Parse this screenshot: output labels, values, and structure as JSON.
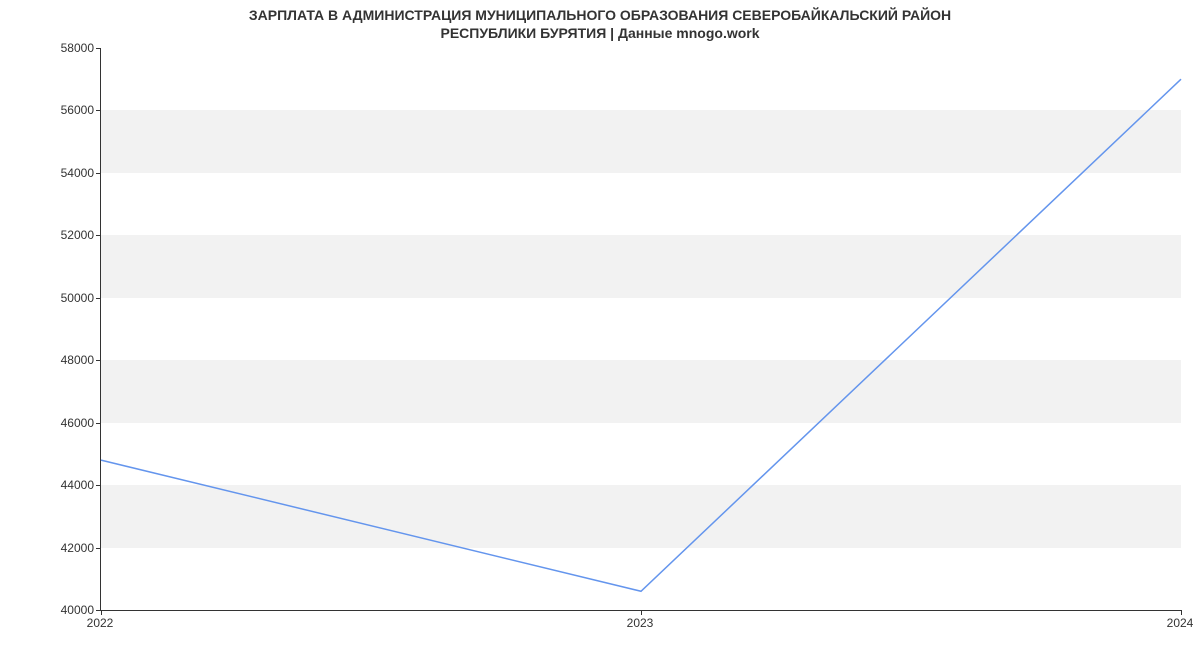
{
  "chart_data": {
    "type": "line",
    "title_line1": "ЗАРПЛАТА В АДМИНИСТРАЦИЯ МУНИЦИПАЛЬНОГО ОБРАЗОВАНИЯ СЕВЕРОБАЙКАЛЬСКИЙ РАЙОН",
    "title_line2": "РЕСПУБЛИКИ БУРЯТИЯ | Данные mnogo.work",
    "xlabel": "",
    "ylabel": "",
    "x": [
      "2022",
      "2023",
      "2024"
    ],
    "y": [
      44800,
      40600,
      57000
    ],
    "x_ticks": [
      "2022",
      "2023",
      "2024"
    ],
    "y_ticks": [
      40000,
      42000,
      44000,
      46000,
      48000,
      50000,
      52000,
      54000,
      56000,
      58000
    ],
    "ylim": [
      40000,
      58000
    ]
  }
}
